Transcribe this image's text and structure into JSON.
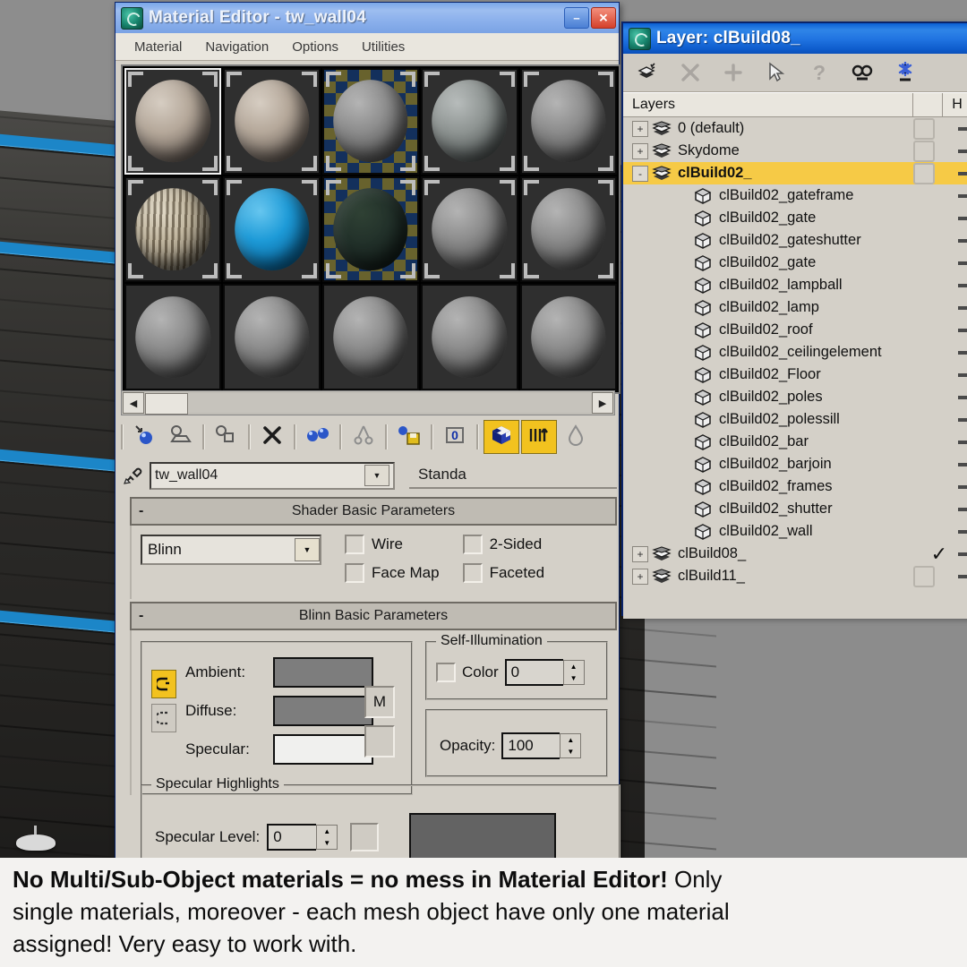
{
  "viewport": {
    "name": "3d-viewport-background"
  },
  "material_editor": {
    "title": "Material Editor - tw_wall04",
    "icon": "max-app-icon",
    "window_buttons": [
      {
        "name": "minimize-button",
        "glyph": "–"
      },
      {
        "name": "close-button",
        "glyph": "✕"
      }
    ],
    "menu": [
      "Material",
      "Navigation",
      "Options",
      "Utilities"
    ],
    "slots": [
      {
        "id": "slot-1",
        "kind": "texture-beige",
        "active": true,
        "checker": false
      },
      {
        "id": "slot-2",
        "kind": "texture-beige",
        "active": false,
        "checker": false
      },
      {
        "id": "slot-3",
        "kind": "plain-gray",
        "active": false,
        "checker": true
      },
      {
        "id": "slot-4",
        "kind": "texture-stone",
        "active": false,
        "checker": false
      },
      {
        "id": "slot-5",
        "kind": "plain-gray",
        "active": false,
        "checker": false
      },
      {
        "id": "slot-6",
        "kind": "texture-striped",
        "active": false,
        "checker": false
      },
      {
        "id": "slot-7",
        "kind": "blue",
        "active": false,
        "checker": false
      },
      {
        "id": "slot-8",
        "kind": "dark-green",
        "active": false,
        "checker": true
      },
      {
        "id": "slot-9",
        "kind": "plain-gray",
        "active": false,
        "checker": false
      },
      {
        "id": "slot-10",
        "kind": "plain-gray",
        "active": false,
        "checker": false
      },
      {
        "id": "slot-11",
        "kind": "plain-gray",
        "active": false,
        "checker": false
      },
      {
        "id": "slot-12",
        "kind": "plain-gray",
        "active": false,
        "checker": false
      },
      {
        "id": "slot-13",
        "kind": "plain-gray",
        "active": false,
        "checker": false
      },
      {
        "id": "slot-14",
        "kind": "plain-gray",
        "active": false,
        "checker": false
      },
      {
        "id": "slot-15",
        "kind": "plain-gray",
        "active": false,
        "checker": false
      }
    ],
    "scroll": {
      "left_arrow": "◀",
      "right_arrow": "▶"
    },
    "toolbar": [
      {
        "name": "get-material-button",
        "icon": "sphere-arrow-icon",
        "active": false
      },
      {
        "name": "put-material-to-scene-button",
        "icon": "sphere-scene-icon",
        "active": false
      },
      {
        "name": "assign-material-button",
        "icon": "sphere-box-icon",
        "active": false
      },
      {
        "name": "reset-map-button",
        "icon": "x-icon",
        "active": false
      },
      {
        "name": "make-material-copy-button",
        "icon": "two-spheres-icon",
        "active": false
      },
      {
        "name": "make-unique-button",
        "icon": "chain-icon",
        "active": false
      },
      {
        "name": "put-to-library-button",
        "icon": "sphere-save-icon",
        "active": false
      },
      {
        "name": "material-effects-button",
        "icon": "zero-channel-icon",
        "active": false
      },
      {
        "name": "show-map-in-viewport-button",
        "icon": "checker-cube-icon",
        "active": true
      },
      {
        "name": "show-end-result-button",
        "icon": "vertical-bars-icon",
        "active": true
      },
      {
        "name": "go-to-parent-button",
        "icon": "water-drop-icon",
        "active": false
      }
    ],
    "material_name": {
      "value": "tw_wall04",
      "picker_icon": "eyedropper-icon",
      "dropdown_glyph": "▼"
    },
    "material_type": "Standa",
    "shader_rollout": {
      "title": "Shader Basic Parameters",
      "collapse_glyph": "-",
      "shader": "Blinn",
      "dropdown_glyph": "▼",
      "checkboxes": [
        {
          "label": "Wire",
          "checked": false
        },
        {
          "label": "2-Sided",
          "checked": false
        },
        {
          "label": "Face Map",
          "checked": false
        },
        {
          "label": "Faceted",
          "checked": false
        }
      ]
    },
    "blinn_rollout": {
      "title": "Blinn Basic Parameters",
      "collapse_glyph": "-",
      "lock_icon": "lock-icon",
      "ambient_diffuse_lock_icon": "ambient-diffuse-lock-icon",
      "diffuse_specular_lock_icon": "diffuse-specular-lock-icon",
      "rows": [
        {
          "label": "Ambient:",
          "swatch": "#7d7d7d",
          "map_button": ""
        },
        {
          "label": "Diffuse:",
          "swatch": "#7d7d7d",
          "map_button": "M"
        },
        {
          "label": "Specular:",
          "swatch": "#f0f0ee",
          "map_button": ""
        }
      ],
      "self_illumination": {
        "title": "Self-Illumination",
        "color_label": "Color",
        "color_checked": false,
        "value": "0"
      },
      "opacity": {
        "label": "Opacity:",
        "value": "100"
      }
    },
    "specular_rollout": {
      "title": "Specular Highlights",
      "specular_level": {
        "label": "Specular Level:",
        "value": "0"
      },
      "curve_swatch": "#636363"
    }
  },
  "layer_dialog": {
    "title": "Layer: clBuild08_",
    "icon": "max-app-icon",
    "toolbar": [
      {
        "name": "create-new-layer-button",
        "icon": "new-layer-icon"
      },
      {
        "name": "delete-layer-button",
        "icon": "x-icon"
      },
      {
        "name": "add-to-layer-button",
        "icon": "plus-icon"
      },
      {
        "name": "select-objects-button",
        "icon": "cursor-arrow-icon"
      },
      {
        "name": "help-button",
        "icon": "question-mark-icon"
      },
      {
        "name": "hide-layer-button",
        "icon": "glasses-icon"
      },
      {
        "name": "freeze-layer-button",
        "icon": "snowflake-icon"
      }
    ],
    "columns": {
      "main": "Layers",
      "blank": "",
      "hide": "H"
    },
    "rows": [
      {
        "name": "0 (default)",
        "type": "layer",
        "expander": "+",
        "indent": 0,
        "selected": false,
        "box": true,
        "check": false
      },
      {
        "name": "Skydome",
        "type": "layer",
        "expander": "+",
        "indent": 0,
        "selected": false,
        "box": true,
        "check": false
      },
      {
        "name": "clBuild02_",
        "type": "layer",
        "expander": "-",
        "indent": 0,
        "selected": true,
        "box": true,
        "check": false
      },
      {
        "name": "clBuild02_gateframe",
        "type": "object",
        "expander": "",
        "indent": 1,
        "selected": false,
        "box": false,
        "check": false
      },
      {
        "name": "clBuild02_gate",
        "type": "object",
        "expander": "",
        "indent": 1,
        "selected": false,
        "box": false,
        "check": false
      },
      {
        "name": "clBuild02_gateshutter",
        "type": "object",
        "expander": "",
        "indent": 1,
        "selected": false,
        "box": false,
        "check": false
      },
      {
        "name": "clBuild02_gate",
        "type": "object",
        "expander": "",
        "indent": 1,
        "selected": false,
        "box": false,
        "check": false
      },
      {
        "name": "clBuild02_lampball",
        "type": "object",
        "expander": "",
        "indent": 1,
        "selected": false,
        "box": false,
        "check": false
      },
      {
        "name": "clBuild02_lamp",
        "type": "object",
        "expander": "",
        "indent": 1,
        "selected": false,
        "box": false,
        "check": false
      },
      {
        "name": "clBuild02_roof",
        "type": "object",
        "expander": "",
        "indent": 1,
        "selected": false,
        "box": false,
        "check": false
      },
      {
        "name": "clBuild02_ceilingelement",
        "type": "object",
        "expander": "",
        "indent": 1,
        "selected": false,
        "box": false,
        "check": false
      },
      {
        "name": "clBuild02_Floor",
        "type": "object",
        "expander": "",
        "indent": 1,
        "selected": false,
        "box": false,
        "check": false
      },
      {
        "name": "clBuild02_poles",
        "type": "object",
        "expander": "",
        "indent": 1,
        "selected": false,
        "box": false,
        "check": false
      },
      {
        "name": "clBuild02_polessill",
        "type": "object",
        "expander": "",
        "indent": 1,
        "selected": false,
        "box": false,
        "check": false
      },
      {
        "name": "clBuild02_bar",
        "type": "object",
        "expander": "",
        "indent": 1,
        "selected": false,
        "box": false,
        "check": false
      },
      {
        "name": "clBuild02_barjoin",
        "type": "object",
        "expander": "",
        "indent": 1,
        "selected": false,
        "box": false,
        "check": false
      },
      {
        "name": "clBuild02_frames",
        "type": "object",
        "expander": "",
        "indent": 1,
        "selected": false,
        "box": false,
        "check": false
      },
      {
        "name": "clBuild02_shutter",
        "type": "object",
        "expander": "",
        "indent": 1,
        "selected": false,
        "box": false,
        "check": false
      },
      {
        "name": "clBuild02_wall",
        "type": "object",
        "expander": "",
        "indent": 1,
        "selected": false,
        "box": false,
        "check": false
      },
      {
        "name": "clBuild08_",
        "type": "layer",
        "expander": "+",
        "indent": 0,
        "selected": false,
        "box": false,
        "check": true
      },
      {
        "name": "clBuild11_",
        "type": "layer",
        "expander": "+",
        "indent": 0,
        "selected": false,
        "box": true,
        "check": false
      }
    ],
    "check_glyph": "✓"
  },
  "caption": {
    "line1_bold": "No Multi/Sub-Object materials = no mess in Material Editor!",
    "line1_rest": " Only",
    "line2": "single materials, moreover - each mesh object have only one material",
    "line3": "assigned! Very easy to work with."
  },
  "colors": {
    "title_active": "#0e5ccc",
    "title_inactive": "#8bb0ec",
    "dialog_face": "#d4d0c8",
    "highlight_row": "#f6ca46",
    "toolbar_active": "#f2c21f",
    "beam_blue": "#1c86c8"
  }
}
